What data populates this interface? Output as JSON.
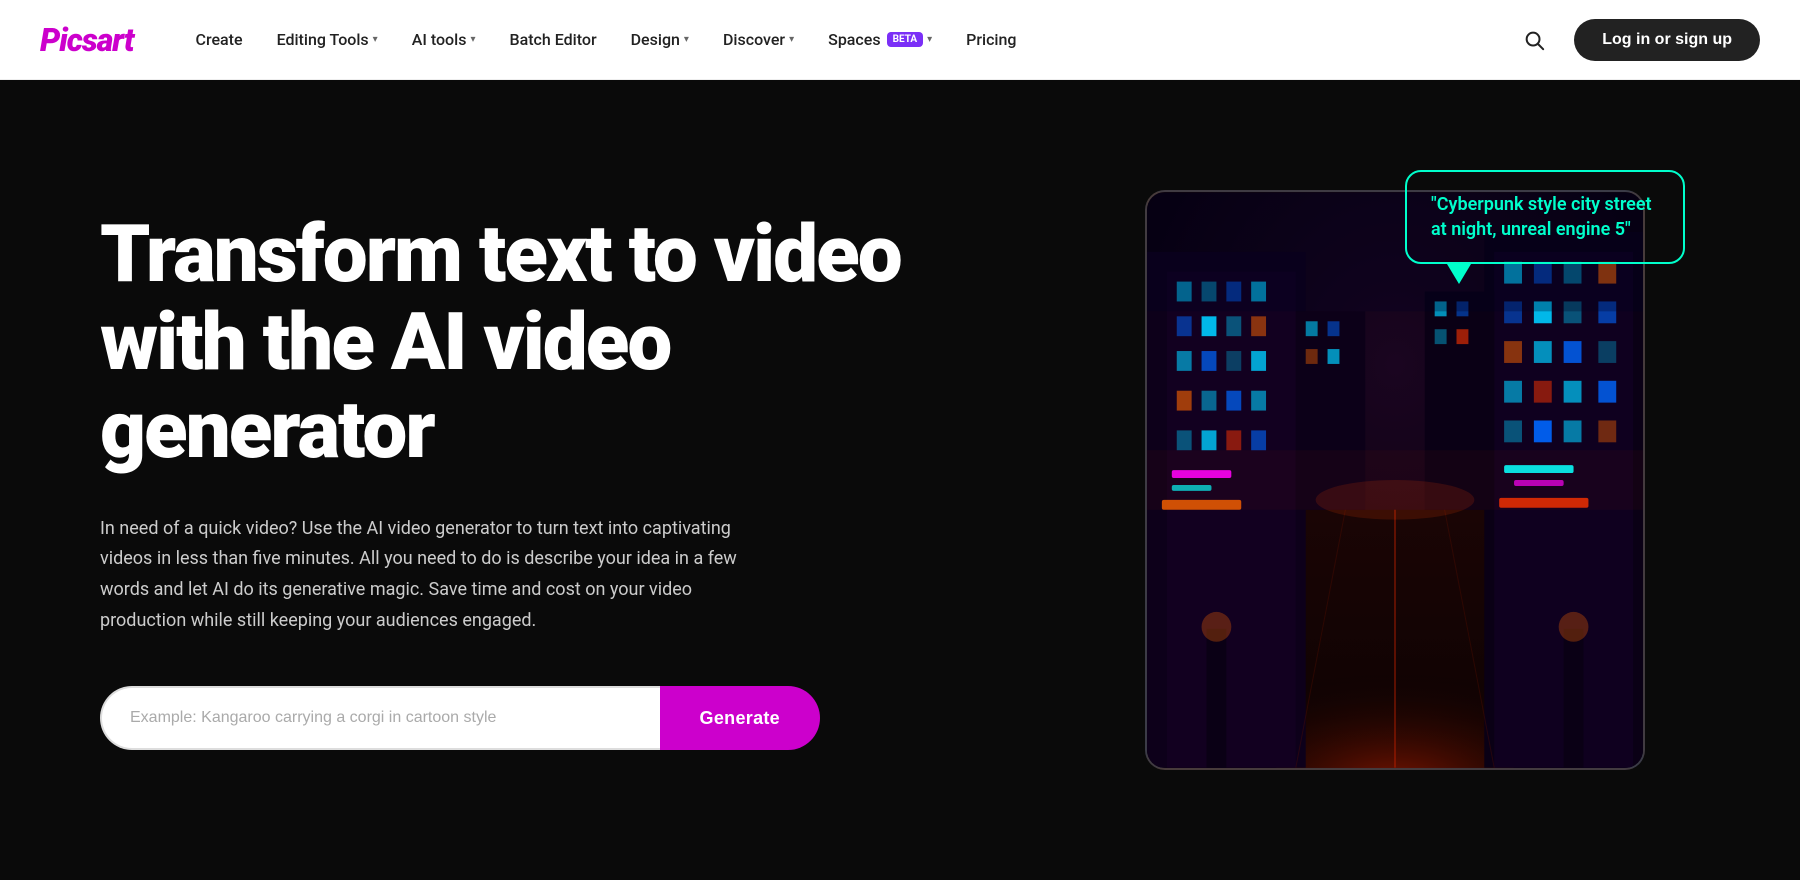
{
  "logo": {
    "text": "Picsart"
  },
  "navbar": {
    "create": "Create",
    "editing_tools": "Editing Tools",
    "ai_tools": "AI tools",
    "batch_editor": "Batch Editor",
    "design": "Design",
    "discover": "Discover",
    "spaces": "Spaces",
    "beta_label": "BETA",
    "pricing": "Pricing",
    "login_label": "Log in or sign up"
  },
  "hero": {
    "title": "Transform text to video with the AI video generator",
    "subtitle": "In need of a quick video? Use the AI video generator to turn text into captivating videos in less than five minutes. All you need to do is describe your idea in a few words and let AI do its generative magic. Save time and cost on your video production while still keeping your audiences engaged.",
    "input_placeholder": "Example: Kangaroo carrying a corgi in cartoon style",
    "generate_label": "Generate",
    "speech_bubble_text": "\"Cyberpunk style city street at night, unreal engine 5\""
  }
}
